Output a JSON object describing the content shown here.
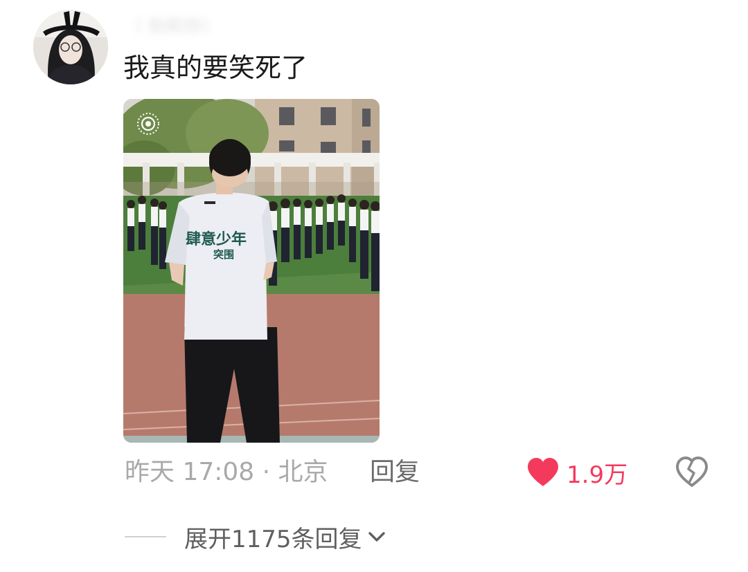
{
  "comment": {
    "username": "（ 别和你）",
    "text": "我真的要笑死了",
    "image": {
      "shirt_print": "肆意少年 突围"
    },
    "meta": {
      "time": "昨天 17:08",
      "separator": " · ",
      "location": "北京"
    },
    "reply_label": "回复",
    "like_count": "1.9万",
    "expand_label": "展开1175条回复"
  },
  "icons": {
    "live": "live-photo-icon",
    "like": "heart-filled-icon",
    "dislike": "broken-heart-icon",
    "expand": "chevron-down-icon"
  },
  "colors": {
    "like_accent": "#f33a5d",
    "secondary_text": "#a9a9a9",
    "reply_text": "#6b6b6b"
  }
}
